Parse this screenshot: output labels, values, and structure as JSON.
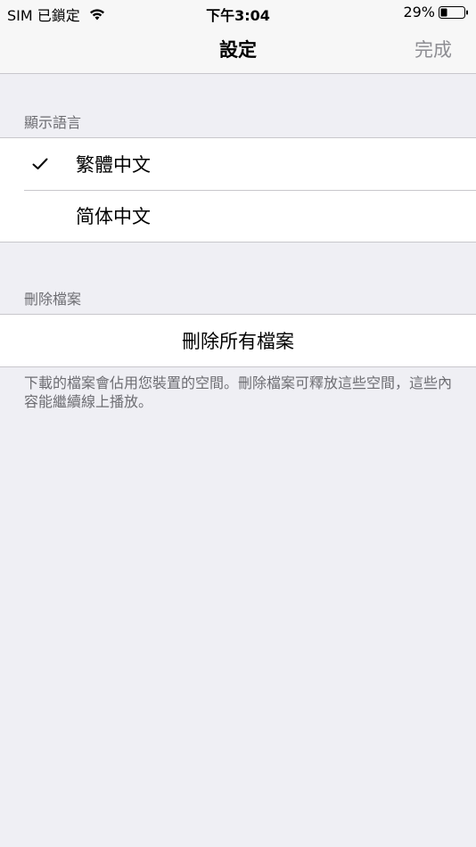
{
  "status_bar": {
    "carrier": "SIM 已鎖定",
    "time": "下午3:04",
    "battery_percent": "29%",
    "battery_level": 0.29,
    "icons": [
      "wifi-icon",
      "battery-icon"
    ]
  },
  "nav": {
    "title": "設定",
    "done_label": "完成"
  },
  "language_section": {
    "header": "顯示語言",
    "options": [
      {
        "label": "繁體中文",
        "selected": true
      },
      {
        "label": "简体中文",
        "selected": false
      }
    ]
  },
  "delete_section": {
    "header": "刪除檔案",
    "action_label": "刪除所有檔案",
    "footer": "下載的檔案會佔用您裝置的空間。刪除檔案可釋放這些空間，這些內容能繼續線上播放。"
  },
  "colors": {
    "background": "#efeff4",
    "separator": "#c8c7cc",
    "secondary_text": "#6d6d72",
    "done_text": "#8e8e93"
  }
}
